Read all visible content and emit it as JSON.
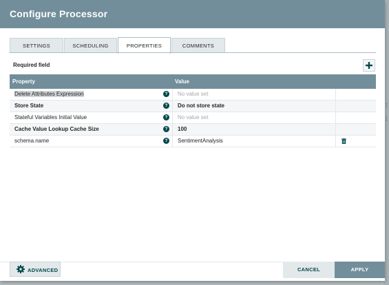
{
  "dialog": {
    "title": "Configure Processor"
  },
  "tabs": [
    {
      "label": "SETTINGS",
      "active": false
    },
    {
      "label": "SCHEDULING",
      "active": false
    },
    {
      "label": "PROPERTIES",
      "active": true
    },
    {
      "label": "COMMENTS",
      "active": false
    }
  ],
  "properties": {
    "required_label": "Required field",
    "add_icon": "plus-icon",
    "columns": {
      "property": "Property",
      "value": "Value"
    },
    "help_glyph": "?",
    "rows": [
      {
        "name": "Delete Attributes Expression",
        "value": "No value set",
        "bold": false,
        "empty": true,
        "deletable": false
      },
      {
        "name": "Store State",
        "value": "Do not store state",
        "bold": true,
        "empty": false,
        "deletable": false
      },
      {
        "name": "Stateful Variables Initial Value",
        "value": "No value set",
        "bold": false,
        "empty": true,
        "deletable": false
      },
      {
        "name": "Cache Value Lookup Cache Size",
        "value": "100",
        "bold": true,
        "empty": false,
        "deletable": false
      },
      {
        "name": "schema.name",
        "value": "SentimentAnalysis",
        "bold": false,
        "empty": false,
        "deletable": true
      }
    ]
  },
  "footer": {
    "advanced_label": "ADVANCED",
    "cancel_label": "CANCEL",
    "apply_label": "APPLY"
  },
  "colors": {
    "header": "#728e9b",
    "accent": "#004849",
    "tab_bg": "#e3e8eb"
  }
}
